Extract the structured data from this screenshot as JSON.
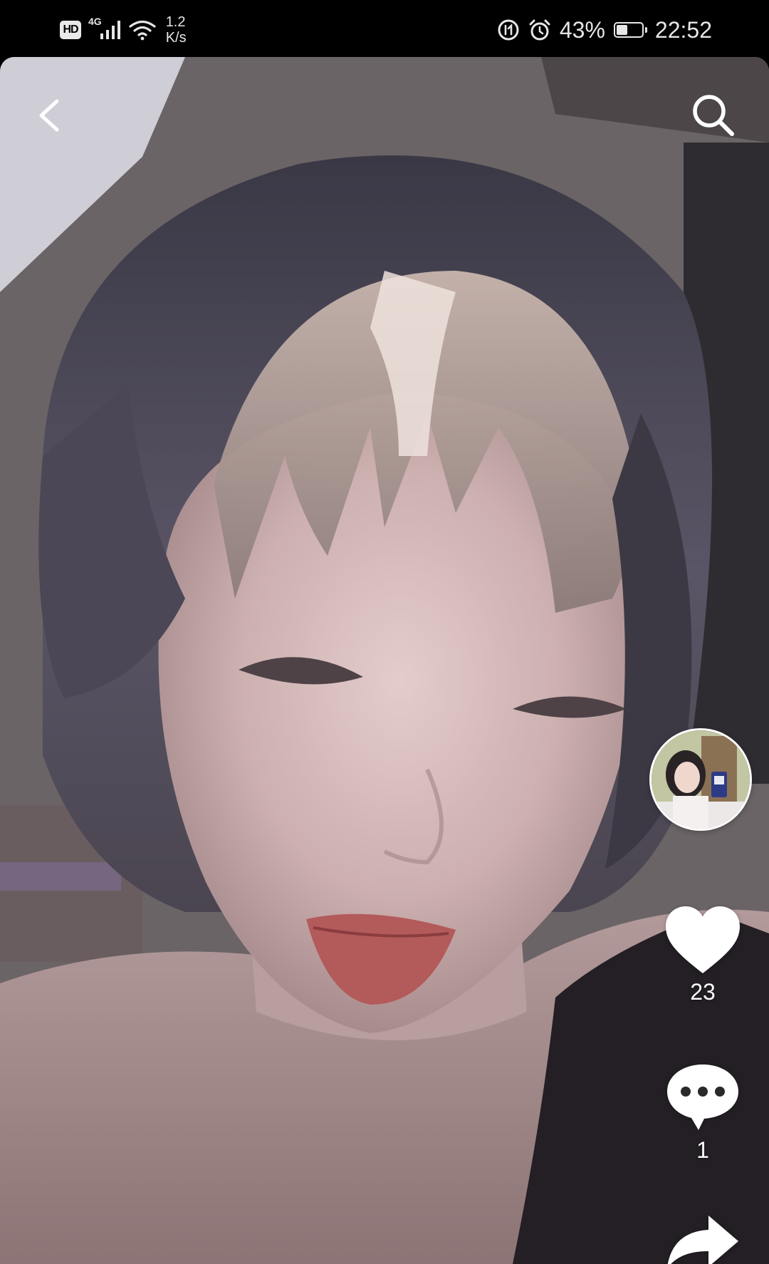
{
  "status_bar": {
    "hd_label": "HD",
    "network_type": "4G",
    "speed_value": "1.2",
    "speed_unit": "K/s",
    "battery_text": "43%",
    "battery_level": 0.43,
    "time": "22:52",
    "icons": [
      "signal-icon",
      "wifi-icon",
      "data-saver-icon",
      "alarm-icon",
      "battery-icon"
    ]
  },
  "overlay": {
    "back_icon": "chevron-left-icon",
    "search_icon": "search-icon"
  },
  "actions": {
    "like_count": "23",
    "comment_count": "1",
    "like_icon": "heart-icon",
    "comment_icon": "comment-bubble-icon",
    "share_icon": "share-arrow-icon"
  },
  "colors": {
    "status_bar_bg": "#000000",
    "icon_color": "#ffffff"
  }
}
